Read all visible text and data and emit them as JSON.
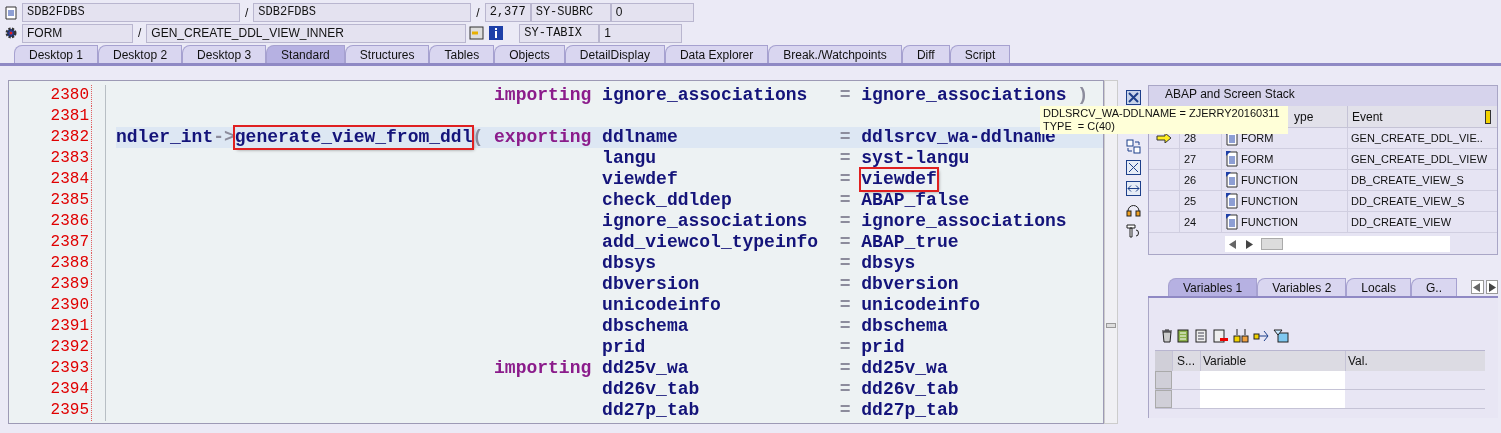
{
  "header": {
    "row1": {
      "program": "SDB2FDBS",
      "sep1": "/",
      "include": "SDB2FDBS",
      "sep2": "/",
      "line": "2,377",
      "sys_field": "SY-SUBRC",
      "sys_value": "0"
    },
    "row2": {
      "kind": "FORM",
      "sep": "/",
      "name": "GEN_CREATE_DDL_VIEW_INNER",
      "sys_field": "SY-TABIX",
      "sys_value": "1"
    }
  },
  "tabs": [
    {
      "label": "Desktop 1",
      "selected": false
    },
    {
      "label": "Desktop 2",
      "selected": false
    },
    {
      "label": "Desktop 3",
      "selected": false
    },
    {
      "label": "Standard",
      "selected": true
    },
    {
      "label": "Structures",
      "selected": false
    },
    {
      "label": "Tables",
      "selected": false
    },
    {
      "label": "Objects",
      "selected": false
    },
    {
      "label": "DetailDisplay",
      "selected": false
    },
    {
      "label": "Data Explorer",
      "selected": false
    },
    {
      "label": "Break./Watchpoints",
      "selected": false
    },
    {
      "label": "Diff",
      "selected": false
    },
    {
      "label": "Script",
      "selected": false
    }
  ],
  "code": {
    "lines": [
      {
        "number": "2380",
        "current": false,
        "keyword": "importing",
        "param": "ignore_associations",
        "assign": "=",
        "value": "ignore_associations",
        "close": ")"
      },
      {
        "number": "2381",
        "current": false
      },
      {
        "number": "2382",
        "current": true,
        "receiver": "ndler_int",
        "arrow": "->",
        "method": "generate_view_from_ddl",
        "method_boxed": true,
        "paren": "(",
        "keyword": "exporting",
        "param": "ddlname",
        "assign": "=",
        "value": "ddlsrcv_wa-ddlname"
      },
      {
        "number": "2383",
        "current": false,
        "param": "langu",
        "assign": "=",
        "value": "syst-langu"
      },
      {
        "number": "2384",
        "current": false,
        "param": "viewdef",
        "assign": "=",
        "value": "viewdef",
        "value_boxed": true
      },
      {
        "number": "2385",
        "current": false,
        "param": "check_ddldep",
        "assign": "=",
        "value": "ABAP_false"
      },
      {
        "number": "2386",
        "current": false,
        "param": "ignore_associations",
        "assign": "=",
        "value": "ignore_associations"
      },
      {
        "number": "2387",
        "current": false,
        "param": "add_viewcol_typeinfo",
        "assign": "=",
        "value": "ABAP_true"
      },
      {
        "number": "2388",
        "current": false,
        "param": "dbsys",
        "assign": "=",
        "value": "dbsys"
      },
      {
        "number": "2389",
        "current": false,
        "param": "dbversion",
        "assign": "=",
        "value": "dbversion"
      },
      {
        "number": "2390",
        "current": false,
        "param": "unicodeinfo",
        "assign": "=",
        "value": "unicodeinfo"
      },
      {
        "number": "2391",
        "current": false,
        "param": "dbschema",
        "assign": "=",
        "value": "dbschema"
      },
      {
        "number": "2392",
        "current": false,
        "param": "prid",
        "assign": "=",
        "value": "prid"
      },
      {
        "number": "2393",
        "current": false,
        "keyword": "importing",
        "param": "dd25v_wa",
        "assign": "=",
        "value": "dd25v_wa"
      },
      {
        "number": "2394",
        "current": false,
        "param": "dd26v_tab",
        "assign": "=",
        "value": "dd26v_tab"
      },
      {
        "number": "2395",
        "current": false,
        "param": "dd27p_tab",
        "assign": "=",
        "value": "dd27p_tab"
      }
    ]
  },
  "tooltip": {
    "lines": [
      "DDLSRCV_WA-DDLNAME = ZJERRY20160311",
      "TYPE  = C(40)"
    ]
  },
  "stack": {
    "title": "ABAP and Screen Stack",
    "columns": [
      "ype",
      "Event"
    ],
    "rows": [
      {
        "current": true,
        "level": "28",
        "type": "FORM",
        "event": "GEN_CREATE_DDL_VIE.."
      },
      {
        "current": false,
        "level": "27",
        "type": "FORM",
        "event": "GEN_CREATE_DDL_VIEW"
      },
      {
        "current": false,
        "level": "26",
        "type": "FUNCTION",
        "event": "DB_CREATE_VIEW_S"
      },
      {
        "current": false,
        "level": "25",
        "type": "FUNCTION",
        "event": "DD_CREATE_VIEW_S"
      },
      {
        "current": false,
        "level": "24",
        "type": "FUNCTION",
        "event": "DD_CREATE_VIEW"
      }
    ]
  },
  "variables": {
    "tabs": [
      {
        "label": "Variables 1",
        "selected": true
      },
      {
        "label": "Variables 2",
        "selected": false
      },
      {
        "label": "Locals",
        "selected": false
      },
      {
        "label": "G..",
        "selected": false
      }
    ],
    "columns": [
      "S...",
      "Variable",
      "Val."
    ]
  }
}
